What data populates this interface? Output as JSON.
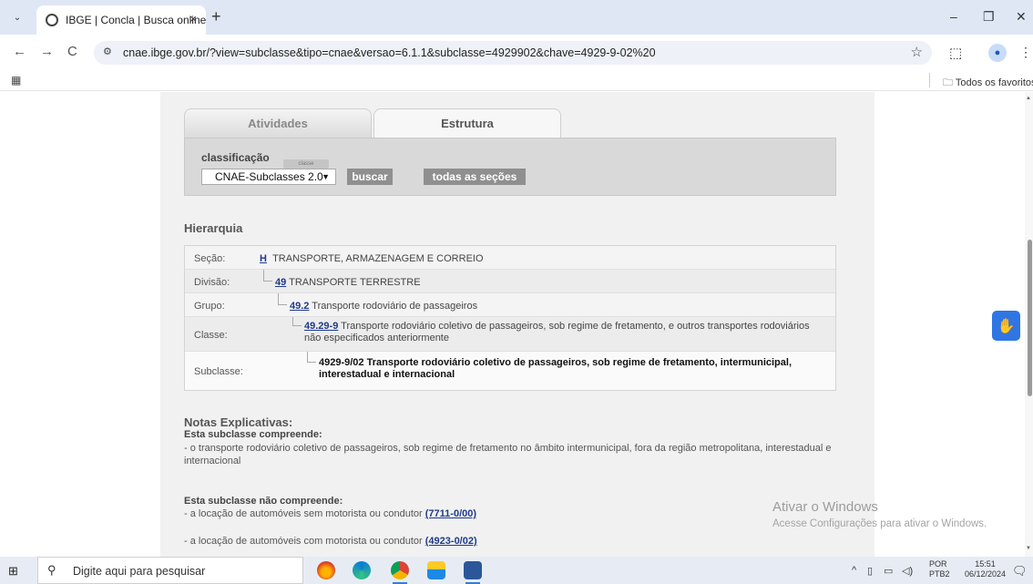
{
  "browser": {
    "tab_title": "IBGE | Concla | Busca online",
    "tab_close": "×",
    "new_tab": "+",
    "url": "cnae.ibge.gov.br/?view=subclasse&tipo=cnae&versao=6.1.1&subclasse=4929902&chave=4929-9-02%20",
    "bookmarks_folder": "Todos os favoritos",
    "profile_initial": "●",
    "window_controls": {
      "minimize": "–",
      "restore": "❐",
      "close": "✕"
    },
    "nav": {
      "back": "←",
      "forward": "→",
      "reload": "C",
      "site_info": "⚙",
      "star": "☆",
      "extensions": "⬚",
      "menu": "⋮",
      "apps": "▦"
    }
  },
  "page": {
    "tabs": [
      {
        "label": "Atividades",
        "active": false
      },
      {
        "label": "Estrutura",
        "active": true
      }
    ],
    "search": {
      "label": "classificação",
      "hint": "classe",
      "selected": "CNAE-Subclasses 2.0",
      "buscar": "buscar",
      "todas": "todas as seções"
    },
    "hierarquia": {
      "title": "Hierarquia",
      "rows": [
        {
          "label": "Seção:",
          "code": "H",
          "text": "TRANSPORTE, ARMAZENAGEM E CORREIO"
        },
        {
          "label": "Divisão:",
          "code": "49",
          "text": "TRANSPORTE TERRESTRE"
        },
        {
          "label": "Grupo:",
          "code": "49.2",
          "text": "Transporte rodoviário de passageiros"
        },
        {
          "label": "Classe:",
          "code": "49.29-9",
          "text": "Transporte rodoviário coletivo de passageiros, sob regime de fretamento, e outros transportes rodoviários não especificados anteriormente"
        },
        {
          "label": "Subclasse:",
          "code": "4929-9/02",
          "text": "Transporte rodoviário coletivo de passageiros, sob regime de fretamento, intermunicipal, interestadual e internacional"
        }
      ]
    },
    "notas": {
      "title": "Notas Explicativas:",
      "compreende_title": "Esta subclasse compreende:",
      "compreende_text": "- o transporte rodoviário coletivo de passageiros, sob regime de fretamento no âmbito intermunicipal, fora da região metropolitana, interestadual e internacional",
      "nao_compreende_title": "Esta subclasse não compreende:",
      "items": [
        {
          "text": "- a locação de automóveis sem motorista ou condutor",
          "link": "(7711-0/00)"
        },
        {
          "text": "- a locação de automóveis com motorista ou condutor",
          "link": "(4923-0/02)"
        }
      ]
    },
    "watermark": {
      "title": "Ativar o Windows",
      "subtitle": "Acesse Configurações para ativar o Windows."
    }
  },
  "taskbar": {
    "search_placeholder": "Digite aqui para pesquisar",
    "lang_top": "POR",
    "lang_bottom": "PTB2",
    "time": "15:51",
    "date": "06/12/2024"
  }
}
